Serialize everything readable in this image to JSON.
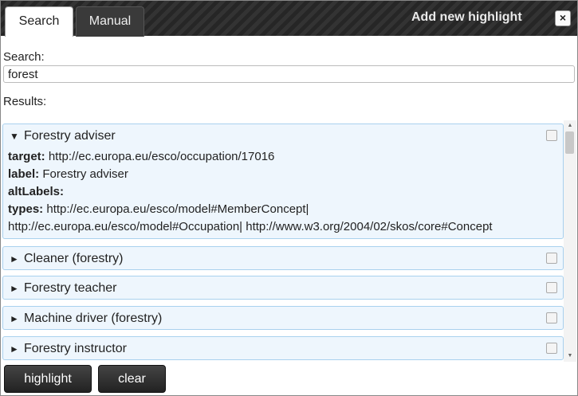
{
  "tabs": [
    {
      "label": "Search",
      "active": true
    },
    {
      "label": "Manual",
      "active": false
    }
  ],
  "dialog": {
    "title": "Add new highlight",
    "close_icon": "×"
  },
  "search": {
    "label": "Search:",
    "value": "forest"
  },
  "results_label": "Results:",
  "results": [
    {
      "label": "Forestry adviser",
      "expanded": true,
      "arrow": "▼",
      "checked": false,
      "details": {
        "target_key": "target:",
        "target_value": "http://ec.europa.eu/esco/occupation/17016",
        "label_key": "label:",
        "label_value": "Forestry adviser",
        "altlabels_key": "altLabels:",
        "types_key": "types:",
        "types_line1": "http://ec.europa.eu/esco/model#MemberConcept|",
        "types_line2": "http://ec.europa.eu/esco/model#Occupation| http://www.w3.org/2004/02/skos/core#Concept"
      }
    },
    {
      "label": "Cleaner (forestry)",
      "expanded": false,
      "arrow": "►",
      "checked": false
    },
    {
      "label": "Forestry teacher",
      "expanded": false,
      "arrow": "►",
      "checked": false
    },
    {
      "label": "Machine driver (forestry)",
      "expanded": false,
      "arrow": "►",
      "checked": false
    },
    {
      "label": "Forestry instructor",
      "expanded": false,
      "arrow": "►",
      "checked": false
    }
  ],
  "scrollbar": {
    "up_glyph": "▲",
    "down_glyph": "▼"
  },
  "buttons": {
    "highlight": "highlight",
    "clear": "clear"
  },
  "colors": {
    "titlebar": "#2b2b2b",
    "item_bg": "#eef6fd",
    "item_border": "#a9d1ee",
    "button_bg": "#333333"
  }
}
